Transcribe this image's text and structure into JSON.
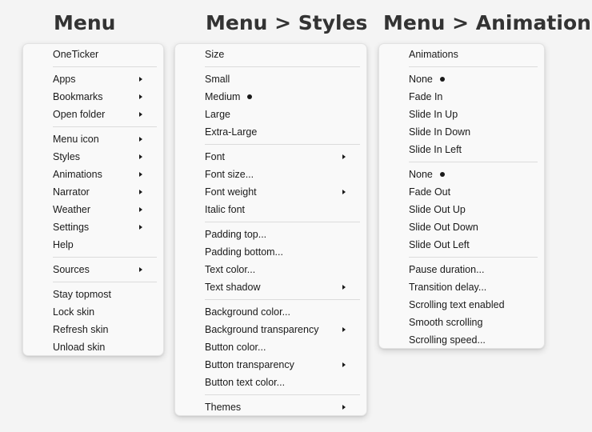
{
  "headings": {
    "menu": "Menu",
    "styles": "Menu > Styles",
    "animations": "Menu > Animations"
  },
  "main_menu": [
    [
      {
        "label": "OneTicker"
      }
    ],
    [
      {
        "label": "Apps",
        "submenu": true
      },
      {
        "label": "Bookmarks",
        "submenu": true
      },
      {
        "label": "Open folder",
        "submenu": true
      }
    ],
    [
      {
        "label": "Menu icon",
        "submenu": true
      },
      {
        "label": "Styles",
        "submenu": true
      },
      {
        "label": "Animations",
        "submenu": true
      },
      {
        "label": "Narrator",
        "submenu": true
      },
      {
        "label": "Weather",
        "submenu": true
      },
      {
        "label": "Settings",
        "submenu": true
      },
      {
        "label": "Help"
      }
    ],
    [
      {
        "label": "Sources",
        "submenu": true
      }
    ],
    [
      {
        "label": "Stay topmost"
      },
      {
        "label": "Lock skin"
      },
      {
        "label": "Refresh skin"
      },
      {
        "label": "Unload skin"
      }
    ]
  ],
  "styles_menu": [
    [
      {
        "label": "Size"
      }
    ],
    [
      {
        "label": "Small"
      },
      {
        "label": "Medium",
        "selected": true
      },
      {
        "label": "Large"
      },
      {
        "label": "Extra-Large"
      }
    ],
    [
      {
        "label": "Font",
        "submenu": true
      },
      {
        "label": "Font size..."
      },
      {
        "label": "Font weight",
        "submenu": true
      },
      {
        "label": "Italic font"
      }
    ],
    [
      {
        "label": "Padding top..."
      },
      {
        "label": "Padding bottom..."
      },
      {
        "label": "Text color..."
      },
      {
        "label": "Text shadow",
        "submenu": true
      }
    ],
    [
      {
        "label": "Background color..."
      },
      {
        "label": "Background transparency",
        "submenu": true
      },
      {
        "label": "Button color..."
      },
      {
        "label": "Button transparency",
        "submenu": true
      },
      {
        "label": "Button text color..."
      }
    ],
    [
      {
        "label": "Themes",
        "submenu": true
      }
    ]
  ],
  "animations_menu": [
    [
      {
        "label": "Animations"
      }
    ],
    [
      {
        "label": "None",
        "selected": true
      },
      {
        "label": "Fade In"
      },
      {
        "label": "Slide In Up"
      },
      {
        "label": "Slide In Down"
      },
      {
        "label": "Slide In Left"
      }
    ],
    [
      {
        "label": "None",
        "selected": true
      },
      {
        "label": "Fade Out"
      },
      {
        "label": "Slide Out Up"
      },
      {
        "label": "Slide Out Down"
      },
      {
        "label": "Slide Out Left"
      }
    ],
    [
      {
        "label": "Pause duration..."
      },
      {
        "label": "Transition delay..."
      },
      {
        "label": "Scrolling text enabled"
      },
      {
        "label": "Smooth scrolling"
      },
      {
        "label": "Scrolling speed..."
      }
    ]
  ]
}
